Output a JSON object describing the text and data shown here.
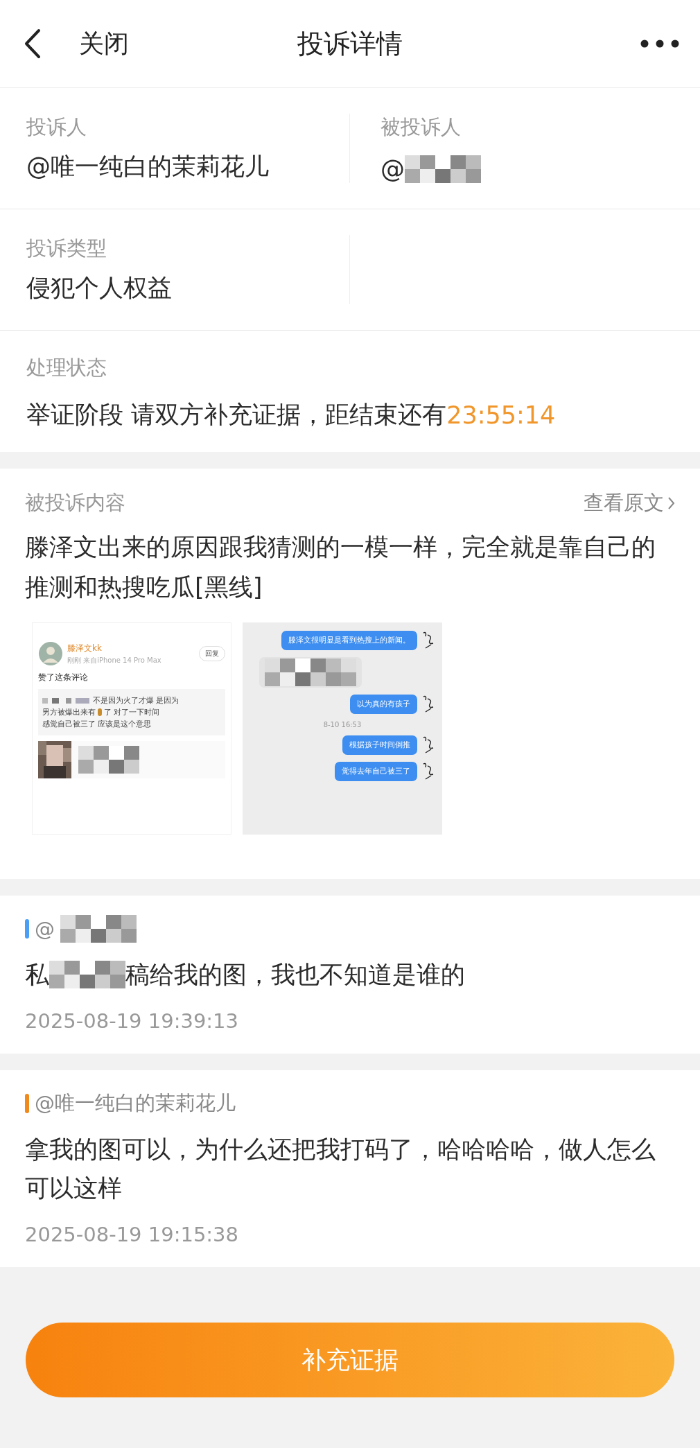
{
  "header": {
    "back": "关闭",
    "title": "投诉详情"
  },
  "parties": [
    {
      "label": "投诉人",
      "value": "@唯一纯白的茉莉花儿",
      "masked": false
    },
    {
      "label": "被投诉人",
      "value": "@",
      "masked": true
    }
  ],
  "complaint_type": {
    "label": "投诉类型",
    "value": "侵犯个人权益"
  },
  "status": {
    "label": "处理状态",
    "text": "举证阶段 请双方补充证据，距结束还有",
    "countdown": "23:55:14"
  },
  "content": {
    "label": "被投诉内容",
    "link": "查看原文",
    "text": "滕泽文出来的原因跟我猜测的一模一样，完全就是靠自己的推测和热搜吃瓜[黑线]",
    "evidence": [
      {
        "kind": "post",
        "name": "滕泽文kk",
        "meta": "刚刚 来自iPhone 14 Pro Max",
        "reply": "回复",
        "action": "赞了这条评论",
        "quote_start": "不是因为火了才爆 是因为",
        "quote_before_emoji": "男方被爆出来有",
        "quote_after_emoji": "了 对了一下时间",
        "quote_end": "感觉自己被三了 应该是这个意思"
      },
      {
        "kind": "chat",
        "messages": [
          {
            "kind": "sent",
            "text": "滕泽文很明显是看到热搜上的新闻。"
          },
          {
            "kind": "masked"
          },
          {
            "kind": "sent",
            "text": "以为真的有孩子"
          },
          {
            "kind": "time",
            "text": "8-10 16:53"
          },
          {
            "kind": "sent",
            "text": "根据孩子时间倒推"
          },
          {
            "kind": "sent",
            "text": "觉得去年自己被三了"
          }
        ]
      }
    ]
  },
  "comments": [
    {
      "color": "#4a9ff5",
      "author": "@",
      "author_masked": true,
      "text_start": "私",
      "text_masked": true,
      "text": "稿给我的图，我也不知道是谁的",
      "time": "2025-08-19 19:39:13"
    },
    {
      "color": "#f08a1c",
      "author": "@唯一纯白的茉莉花儿",
      "author_masked": false,
      "text_masked": false,
      "text": "拿我的图可以，为什么还把我打码了，哈哈哈哈，做人怎么可以这样",
      "time": "2025-08-19 19:15:38"
    }
  ],
  "button": "补充证据"
}
